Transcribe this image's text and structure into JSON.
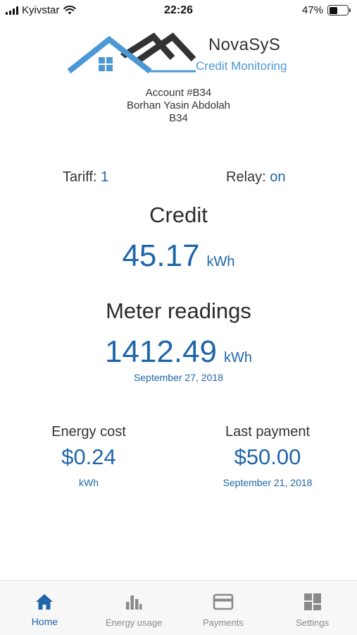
{
  "status_bar": {
    "carrier": "Kyivstar",
    "time": "22:26",
    "battery": "47%",
    "battery_level": 0.47
  },
  "brand": {
    "name": "NovaSyS",
    "subtitle": "Credit Monitoring",
    "accent_color": "#4b98d4",
    "roof_color": "#333333"
  },
  "account": {
    "number": "Account #B34",
    "name": "Borhan Yasin Abdolah",
    "code": "B34"
  },
  "tariff": {
    "label": "Tariff:",
    "value": "1"
  },
  "relay": {
    "label": "Relay:",
    "value": "on"
  },
  "credit": {
    "title": "Credit",
    "value": "45.17",
    "unit": "kWh"
  },
  "meter": {
    "title": "Meter readings",
    "value": "1412.49",
    "unit": "kWh",
    "date": "September 27, 2018"
  },
  "energy_cost": {
    "label": "Energy cost",
    "value": "$0.24",
    "unit": "kWh"
  },
  "last_payment": {
    "label": "Last payment",
    "value": "$50.00",
    "date": "September 21, 2018"
  },
  "tabs": [
    {
      "label": "Home",
      "icon": "home-icon",
      "active": true
    },
    {
      "label": "Energy usage",
      "icon": "bar-chart-icon",
      "active": false
    },
    {
      "label": "Payments",
      "icon": "credit-card-icon",
      "active": false
    },
    {
      "label": "Settings",
      "icon": "grid-icon",
      "active": false
    }
  ],
  "colors": {
    "primary": "#1f66a8",
    "inactive": "#8a8a8a"
  }
}
